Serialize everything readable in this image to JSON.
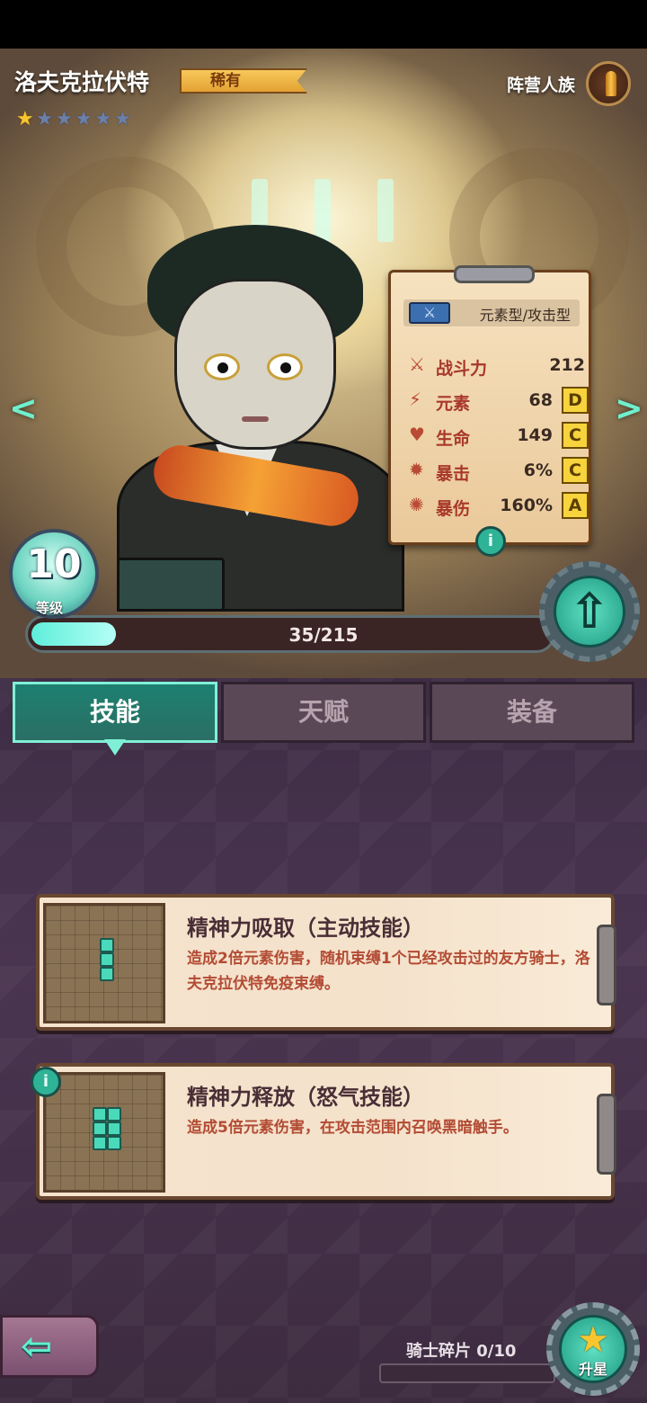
{
  "hero": {
    "name": "洛夫克拉伏特",
    "rarity": "稀有",
    "stars_filled": 1,
    "stars_total": 6,
    "faction": "阵营人族",
    "faction_icon": "bullet-icon"
  },
  "stats_card": {
    "type": "元素型/攻击型",
    "type_icon": "sword-icon",
    "rows": [
      {
        "icon": "crossed-swords-icon",
        "label": "战斗力",
        "value": "212",
        "grade": ""
      },
      {
        "icon": "lightning-icon",
        "label": "元素",
        "value": "68",
        "grade": "D"
      },
      {
        "icon": "heart-icon",
        "label": "生命",
        "value": "149",
        "grade": "C"
      },
      {
        "icon": "crit-icon",
        "label": "暴击",
        "value": "6%",
        "grade": "C"
      },
      {
        "icon": "crit-damage-icon",
        "label": "暴伤",
        "value": "160%",
        "grade": "A"
      }
    ],
    "info_label": "i"
  },
  "level": {
    "value": "10",
    "label": "等级",
    "xp_text": "35/215",
    "xp_current": 35,
    "xp_max": 215
  },
  "tabs": [
    {
      "label": "技能",
      "active": true
    },
    {
      "label": "天赋",
      "active": false
    },
    {
      "label": "装备",
      "active": false
    }
  ],
  "skills": [
    {
      "title": "精神力吸取（主动技能）",
      "description": "造成2倍元素伤害，随机束缚1个已经攻击过的友方骑士，洛夫克拉伏特免疫束缚。"
    },
    {
      "title": "精神力释放（怒气技能）",
      "description": "造成5倍元素伤害，在攻击范围内召唤黑暗触手。"
    }
  ],
  "footer": {
    "shards_label": "骑士碎片 0/10",
    "shards_current": 0,
    "shards_max": 10,
    "star_up_label": "升星"
  },
  "colors": {
    "accent": "#5ef0cf",
    "grade": "#f7d33d",
    "stat_label": "#a8382a"
  }
}
